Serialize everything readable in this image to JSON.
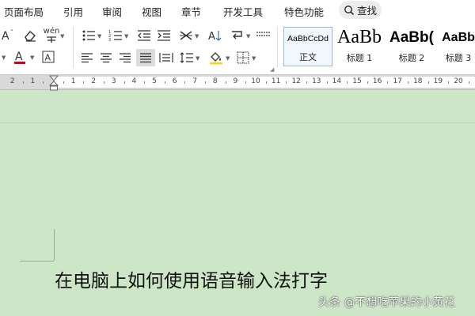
{
  "menu": {
    "items": [
      "页面布局",
      "引用",
      "审阅",
      "视图",
      "章节",
      "开发工具",
      "特色功能"
    ],
    "search_label": "查找"
  },
  "toolbar": {
    "phonetic_label": "wén",
    "font_color": "#d0021b",
    "highlight_color": "#ffd400"
  },
  "styles": [
    {
      "sample": "AaBbCcDd",
      "name": "正文"
    },
    {
      "sample": "AaBb",
      "name": "标题 1"
    },
    {
      "sample": "AaBb(",
      "name": "标题 2"
    },
    {
      "sample": "AaBb",
      "name": "标题 3"
    }
  ],
  "ruler": {
    "left_numbers": [
      "2",
      "1"
    ],
    "right_numbers": [
      "1",
      "2",
      "3",
      "4",
      "5",
      "6",
      "7",
      "8",
      "9",
      "10",
      "11",
      "12",
      "13",
      "14",
      "15",
      "16",
      "17",
      "18",
      "19",
      "20"
    ]
  },
  "document": {
    "text": "在电脑上如何使用语音输入法打字"
  },
  "watermark": "头条 @不想吃苹果的小黄花"
}
